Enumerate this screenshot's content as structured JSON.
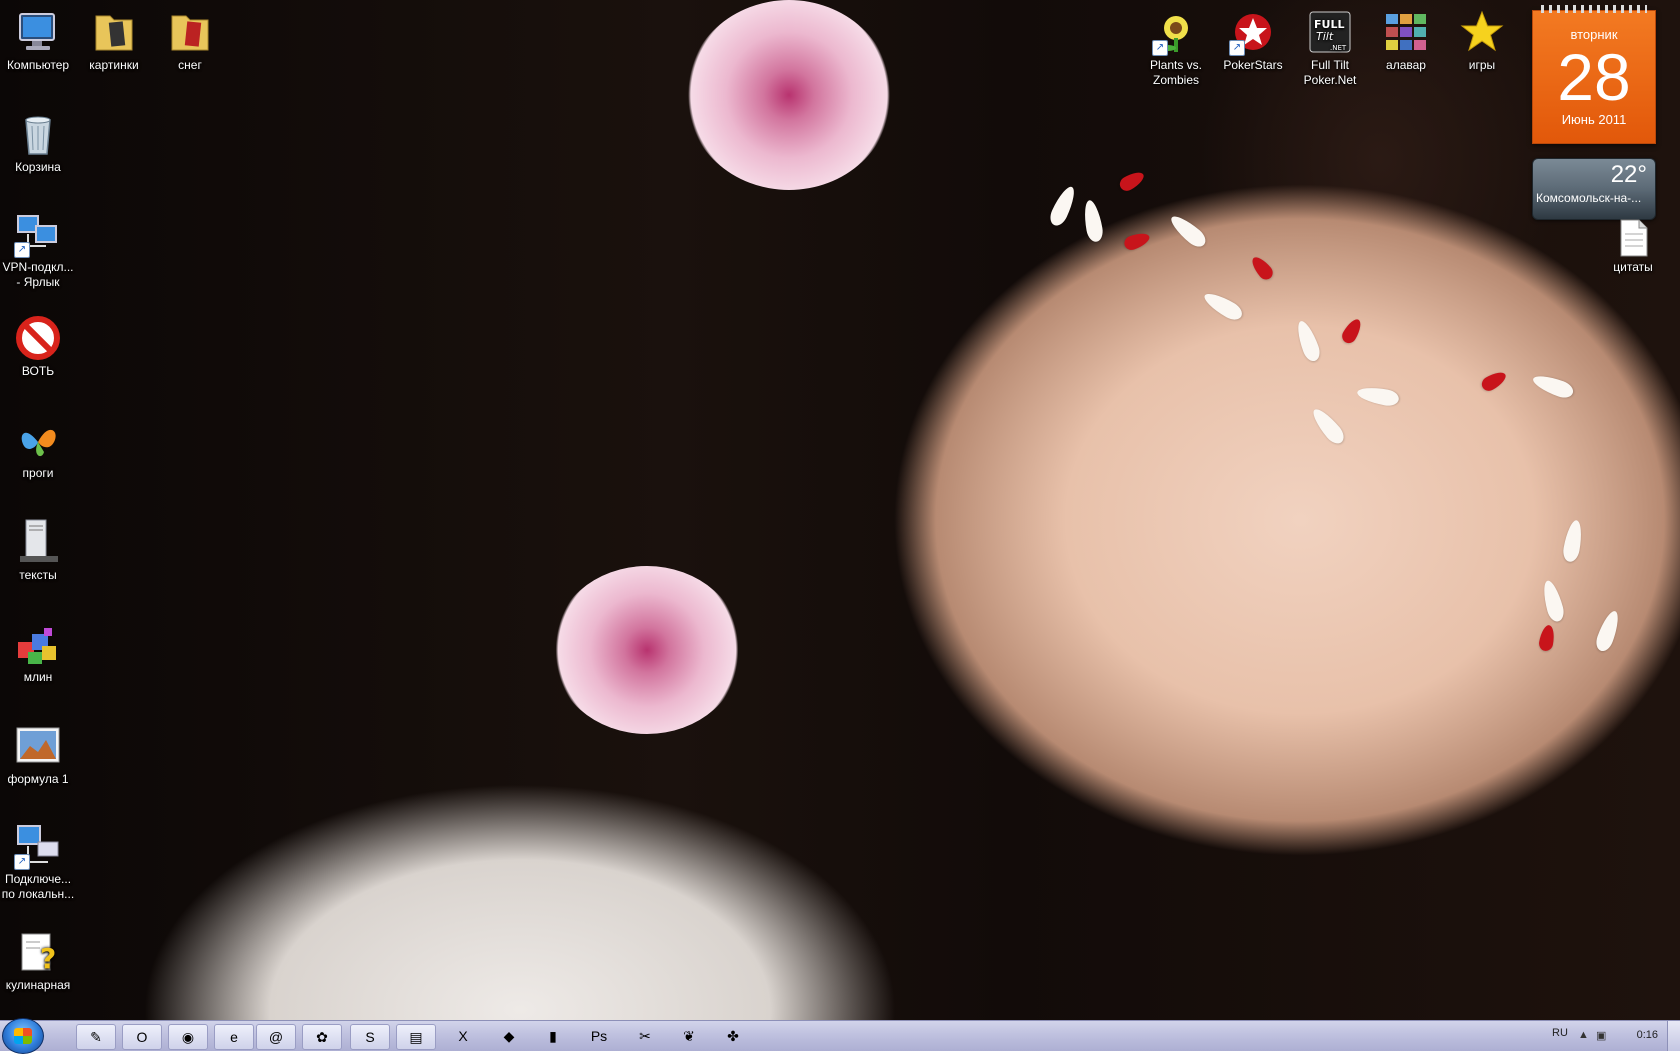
{
  "desktop_icons_left": [
    {
      "label": "Компьютер",
      "icon": "computer-icon"
    },
    {
      "label": "Корзина",
      "icon": "recycle-bin-icon"
    },
    {
      "label": "VPN-подкл... - Ярлык",
      "icon": "network-connection-icon"
    },
    {
      "label": "ВОТЬ",
      "icon": "no-sign-icon"
    },
    {
      "label": "проги",
      "icon": "msn-butterfly-icon"
    },
    {
      "label": "тексты",
      "icon": "server-icon"
    },
    {
      "label": "млин",
      "icon": "blocks-icon"
    },
    {
      "label": "формула 1",
      "icon": "picture-icon"
    },
    {
      "label": "Подключе... по локальн...",
      "icon": "lan-connection-icon"
    },
    {
      "label": "кулинарная",
      "icon": "help-document-icon"
    }
  ],
  "desktop_icons_top": [
    {
      "label": "картинки",
      "icon": "folder-icon"
    },
    {
      "label": "снег",
      "icon": "folder-icon"
    }
  ],
  "desktop_icons_right": [
    {
      "label": "Plants vs. Zombies",
      "icon": "plants-vs-zombies-icon"
    },
    {
      "label": "PokerStars",
      "icon": "pokerstars-icon"
    },
    {
      "label": "Full Tilt Poker.Net",
      "icon": "full-tilt-poker-icon"
    },
    {
      "label": "алавар",
      "icon": "alawar-icon"
    },
    {
      "label": "игры",
      "icon": "star-icon"
    }
  ],
  "desktop_icon_citaty": {
    "label": "цитаты",
    "icon": "text-document-icon"
  },
  "calendar": {
    "weekday": "вторник",
    "day": "28",
    "month": "Июнь 2011"
  },
  "weather": {
    "temperature": "22°",
    "city": "Комсомольск-на-..."
  },
  "taskbar": {
    "items": [
      {
        "icon": "pencil-icon",
        "glyph": "✎"
      },
      {
        "icon": "opera-icon",
        "glyph": "O"
      },
      {
        "icon": "firefox-icon",
        "glyph": "◉"
      },
      {
        "icon": "internet-explorer-icon",
        "glyph": "e"
      },
      {
        "icon": "mail-agent-icon",
        "glyph": "@"
      },
      {
        "icon": "icq-icon",
        "glyph": "✿"
      },
      {
        "icon": "skype-icon",
        "glyph": "S"
      },
      {
        "icon": "notepad-icon",
        "glyph": "▤"
      },
      {
        "icon": "excel-icon",
        "glyph": "X"
      },
      {
        "icon": "games-icon",
        "glyph": "◆"
      },
      {
        "icon": "film-icon",
        "glyph": "▮"
      },
      {
        "icon": "photoshop-icon",
        "glyph": "Ps"
      },
      {
        "icon": "tool-icon",
        "glyph": "✂"
      },
      {
        "icon": "butterfly-icon",
        "glyph": "❦"
      },
      {
        "icon": "utility-icon",
        "glyph": "✤"
      }
    ],
    "language": "RU",
    "clock": "0:16"
  },
  "colors": {
    "calendar_orange": "#ee6b16",
    "taskbar": "#c3c5e2"
  }
}
